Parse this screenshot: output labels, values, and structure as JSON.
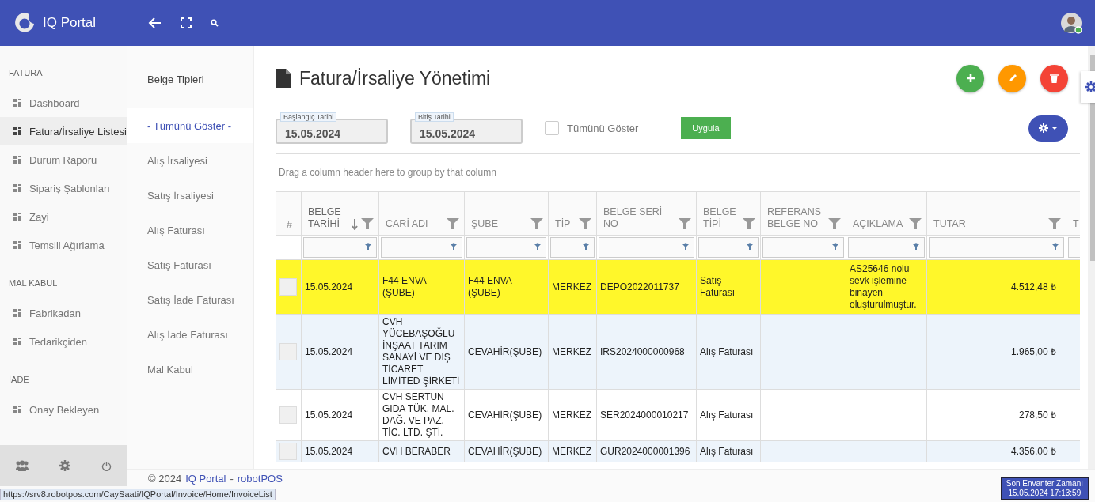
{
  "header": {
    "title": "IQ Portal"
  },
  "sidebar": {
    "sections": [
      {
        "heading": "FATURA",
        "items": [
          {
            "label": "Dashboard",
            "selected": false
          },
          {
            "label": "Fatura/İrsaliye Listesi",
            "selected": true
          },
          {
            "label": "Durum Raporu",
            "selected": false
          },
          {
            "label": "Sipariş Şablonları",
            "selected": false
          },
          {
            "label": "Zayi",
            "selected": false
          },
          {
            "label": "Temsili Ağırlama",
            "selected": false
          }
        ]
      },
      {
        "heading": "MAL KABUL",
        "items": [
          {
            "label": "Fabrikadan",
            "selected": false
          },
          {
            "label": "Tedarikçiden",
            "selected": false
          }
        ]
      },
      {
        "heading": "İADE",
        "items": [
          {
            "label": "Onay Bekleyen",
            "selected": false
          }
        ]
      }
    ]
  },
  "doc_types": {
    "heading": "Belge Tipleri",
    "items": [
      {
        "label": "- Tümünü Göster -",
        "selected": true
      },
      {
        "label": "Alış İrsaliyesi",
        "selected": false
      },
      {
        "label": "Satış İrsaliyesi",
        "selected": false
      },
      {
        "label": "Alış Faturası",
        "selected": false
      },
      {
        "label": "Satış Faturası",
        "selected": false
      },
      {
        "label": "Satış İade Faturası",
        "selected": false
      },
      {
        "label": "Alış İade Faturası",
        "selected": false
      },
      {
        "label": "Mal Kabul",
        "selected": false
      }
    ]
  },
  "page": {
    "title": "Fatura/İrsaliye Yönetimi"
  },
  "filters": {
    "start": {
      "label": "Başlangıç Tarihi",
      "value": "15.05.2024"
    },
    "end": {
      "label": "Bitiş Tarihi",
      "value": "15.05.2024"
    },
    "show_all": {
      "label": "Tümünü Göster",
      "checked": false
    },
    "apply": "Uygula"
  },
  "group_hint": "Drag a column header here to group by that column",
  "table": {
    "index_label": "#",
    "columns": [
      {
        "label": "BELGE TARİHİ",
        "kind": "data",
        "sorted": true
      },
      {
        "label": "CARİ ADI",
        "kind": "data",
        "sorted": false
      },
      {
        "label": "ŞUBE",
        "kind": "data",
        "sorted": false
      },
      {
        "label": "TİP",
        "kind": "data",
        "sorted": false
      },
      {
        "label": "BELGE SERİ NO",
        "kind": "data",
        "sorted": false
      },
      {
        "label": "BELGE TİPİ",
        "kind": "data",
        "sorted": false
      },
      {
        "label": "REFERANS BELGE NO",
        "kind": "data",
        "sorted": false
      },
      {
        "label": "AÇIKLAMA",
        "kind": "data",
        "sorted": false
      },
      {
        "label": "TUTAR",
        "kind": "money",
        "sorted": false
      },
      {
        "label": "T",
        "kind": "partial",
        "sorted": false
      }
    ],
    "rows": [
      {
        "selected": true,
        "checked": false,
        "cells": [
          "15.05.2024",
          "F44 ENVA (ŞUBE)",
          "F44 ENVA (ŞUBE)",
          "MERKEZ",
          "DEPO2022011737",
          "Satış Faturası",
          "",
          "AS25646 nolu sevk işlemine binayen oluşturulmuştur.",
          "4.512,48 ₺",
          ""
        ]
      },
      {
        "selected": false,
        "checked": false,
        "cells": [
          "15.05.2024",
          "CVH YÜCEBAŞOĞLU İNŞAAT TARIM SANAYİ VE DIŞ TİCARET LİMİTED ŞİRKETİ",
          "CEVAHİR(ŞUBE)",
          "MERKEZ",
          "IRS2024000000968",
          "Alış Faturası",
          "",
          "",
          "1.965,00 ₺",
          ""
        ]
      },
      {
        "selected": false,
        "checked": false,
        "cells": [
          "15.05.2024",
          "CVH SERTUN GIDA TÜK. MAL. DAĞ. VE PAZ. TİC. LTD. ŞTİ.",
          "CEVAHİR(ŞUBE)",
          "MERKEZ",
          "SER2024000010217",
          "Alış Faturası",
          "",
          "",
          "278,50 ₺",
          ""
        ]
      },
      {
        "selected": false,
        "checked": false,
        "cells": [
          "15.05.2024",
          "CVH BERABER",
          "CEVAHİR(ŞUBE)",
          "MERKEZ",
          "GUR2024000001396",
          "Alış Faturası",
          "",
          "",
          "4.356,00 ₺",
          ""
        ]
      }
    ]
  },
  "footer": {
    "copyright": "© 2024",
    "links": [
      "IQ Portal",
      "robotPOS"
    ],
    "separator": "-"
  },
  "status_url": "https://srv8.robotpos.com/CaySaati/IQPortal/Invoice/Home/InvoiceList",
  "inventory": {
    "label": "Son Envanter Zamanı",
    "value": "15.05.2024 17:13:59"
  }
}
